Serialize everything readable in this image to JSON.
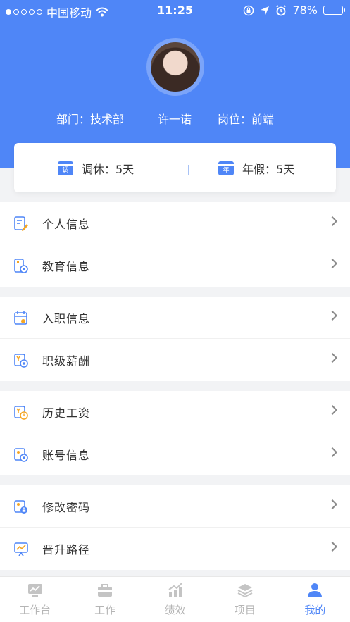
{
  "status_bar": {
    "carrier": "中国移动",
    "time": "11:25",
    "battery": "78%",
    "battery_level": 0.78
  },
  "profile": {
    "department": "部门：技术部",
    "name": "许一诺",
    "position": "岗位：前端"
  },
  "leave": {
    "compensatory_icon": "调",
    "compensatory": "调休：5天",
    "annual_icon": "年",
    "annual": "年假：5天"
  },
  "menu_groups": [
    {
      "items": [
        {
          "label": "个人信息",
          "icon": "personal-info-icon"
        },
        {
          "label": "教育信息",
          "icon": "education-icon"
        }
      ]
    },
    {
      "items": [
        {
          "label": "入职信息",
          "icon": "onboarding-icon"
        },
        {
          "label": "职级薪酬",
          "icon": "salary-grade-icon"
        }
      ]
    },
    {
      "items": [
        {
          "label": "历史工资",
          "icon": "salary-history-icon"
        },
        {
          "label": "账号信息",
          "icon": "account-icon"
        }
      ]
    },
    {
      "items": [
        {
          "label": "修改密码",
          "icon": "password-icon"
        },
        {
          "label": "晋升路径",
          "icon": "promotion-icon"
        }
      ]
    }
  ],
  "tabbar": {
    "tabs": [
      {
        "label": "工作台",
        "icon": "dashboard-icon"
      },
      {
        "label": "工作",
        "icon": "briefcase-icon"
      },
      {
        "label": "绩效",
        "icon": "performance-icon"
      },
      {
        "label": "项目",
        "icon": "layers-icon"
      },
      {
        "label": "我的",
        "icon": "user-icon"
      }
    ],
    "active": 4
  },
  "colors": {
    "accent": "#4f86f7",
    "icon_orange": "#f5a623"
  }
}
